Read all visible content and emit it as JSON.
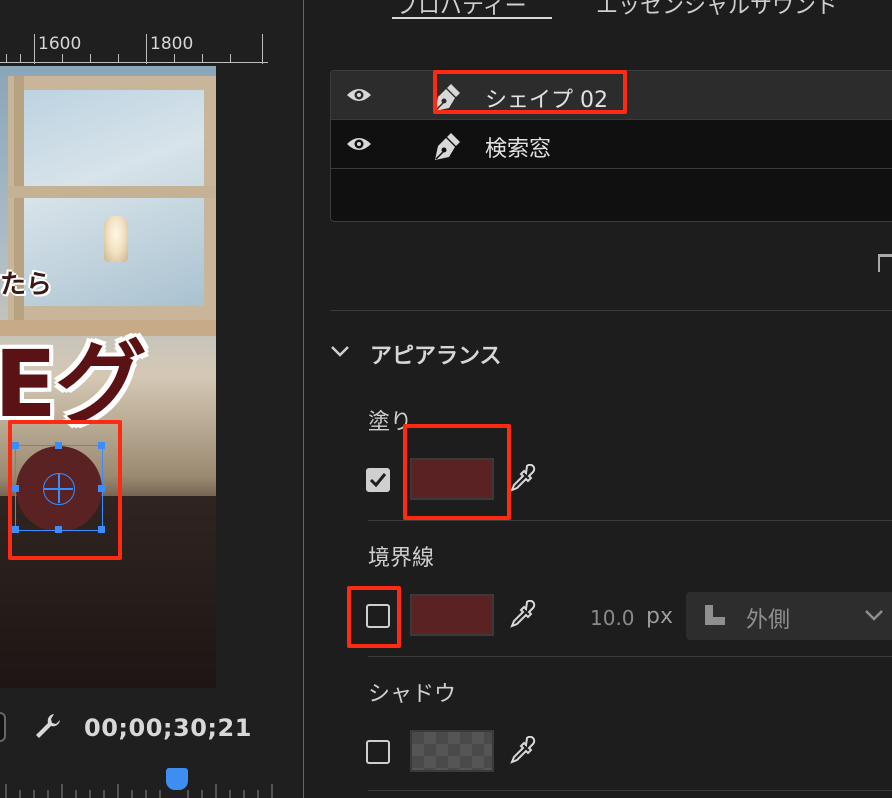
{
  "monitor": {
    "ruler_ticks": [
      "1600",
      "1800"
    ],
    "overlay_text_small": "たら",
    "overlay_text_big": "Eグ",
    "timecode": "00;00;30;21"
  },
  "panel": {
    "tabs": [
      "プロパティー",
      "エッセンシャルサウンド"
    ],
    "layers": [
      {
        "name": "シェイプ 02",
        "selected": true
      },
      {
        "name": "検索窓",
        "selected": false
      }
    ],
    "appearance": {
      "section_label": "アピアランス",
      "fill": {
        "label": "塗り",
        "checked": true,
        "color": "#5a2223"
      },
      "stroke": {
        "label": "境界線",
        "checked": false,
        "color": "#5a2223",
        "width": "10.0",
        "unit": "px",
        "position": "外側"
      },
      "shadow": {
        "label": "シャドウ",
        "checked": false
      }
    }
  },
  "colors": {
    "highlight": "#ff2a12",
    "accent": "#3a8dff",
    "panel_bg": "#1d1d1d"
  }
}
